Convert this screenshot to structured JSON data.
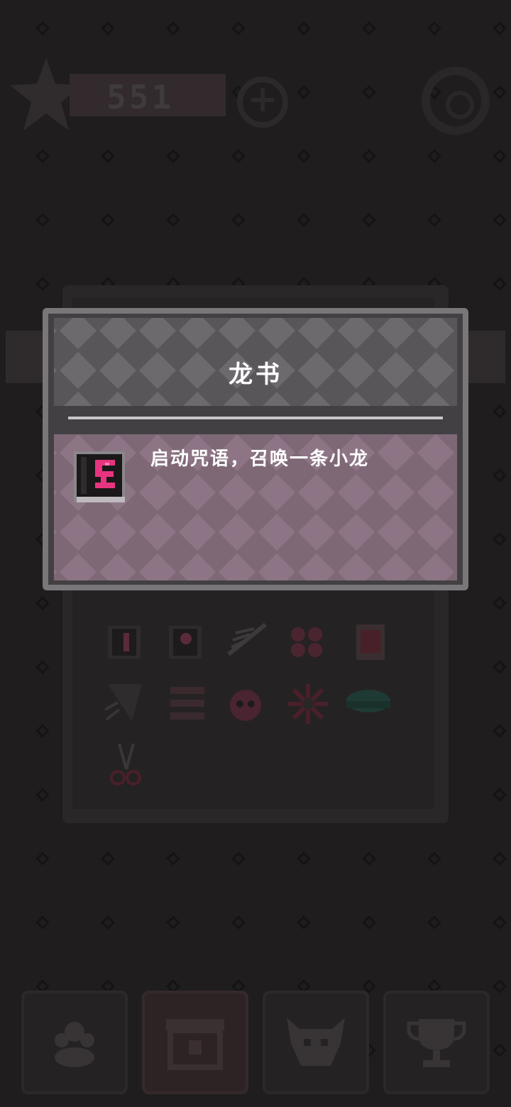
{
  "hud": {
    "coins": "551",
    "star_icon": "star-icon",
    "add_icon": "plus-icon",
    "settings_icon": "settings-icon"
  },
  "popup": {
    "title": "龙书",
    "description": "启动咒语，召唤一条小龙",
    "item_icon": "dragon-book-icon"
  },
  "inventory": {
    "items": [
      "boot-book-icon",
      "balloon-book-icon",
      "wing-blade-icon",
      "butterfly-icon",
      "red-card-icon",
      "spiked-claw-icon",
      "stack-icon",
      "skull-bomb-icon",
      "spark-icon",
      "green-disc-icon",
      "scissors-icon"
    ]
  },
  "nav": {
    "items": [
      "characters-icon",
      "shop-icon",
      "monster-icon",
      "trophy-icon"
    ]
  },
  "colors": {
    "background": "#1f1d1e",
    "popup_border": "#7a777a",
    "popup_body": "#7e6876",
    "accent_pink": "#e8347f"
  }
}
